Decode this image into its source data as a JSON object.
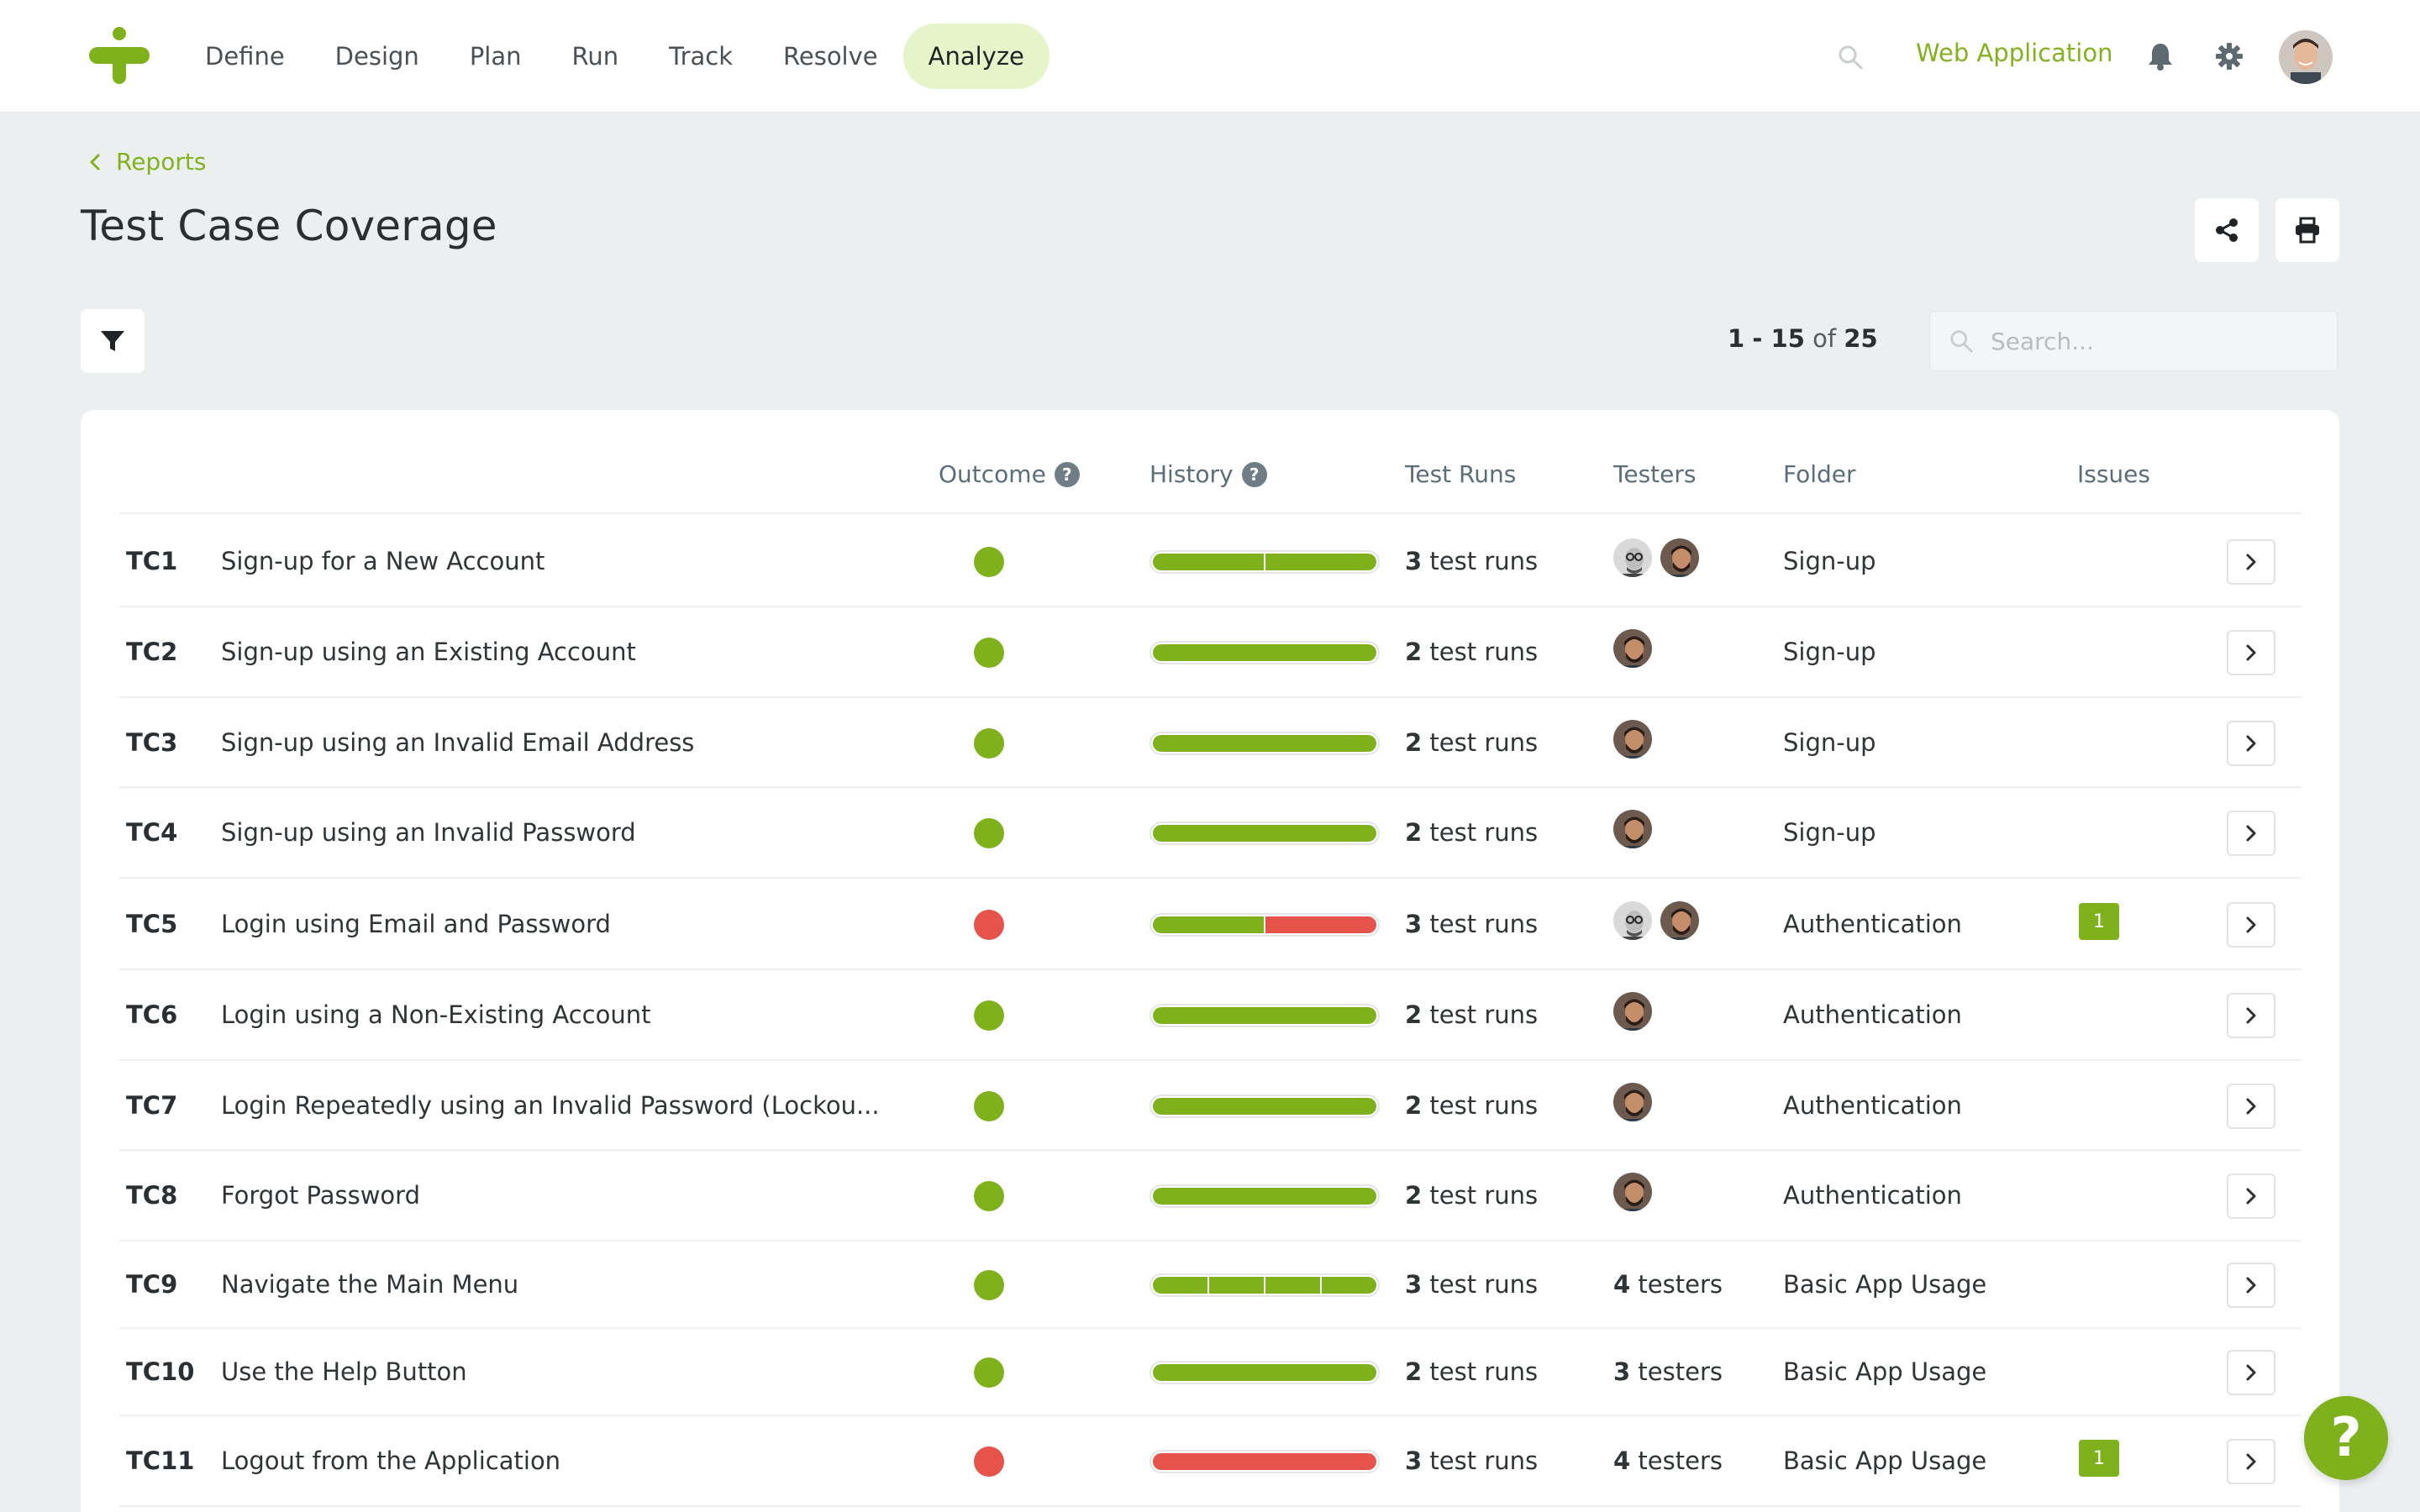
{
  "nav": {
    "items": [
      {
        "label": "Define",
        "active": false
      },
      {
        "label": "Design",
        "active": false
      },
      {
        "label": "Plan",
        "active": false
      },
      {
        "label": "Run",
        "active": false
      },
      {
        "label": "Track",
        "active": false
      },
      {
        "label": "Resolve",
        "active": false
      },
      {
        "label": "Analyze",
        "active": true
      }
    ],
    "project": "Web Application"
  },
  "breadcrumb": "Reports",
  "title": "Test Case Coverage",
  "pager": {
    "from": "1",
    "to": "15",
    "of_label": "of",
    "total": "25"
  },
  "search": {
    "placeholder": "Search..."
  },
  "columns": {
    "outcome": "Outcome",
    "history": "History",
    "test_runs": "Test Runs",
    "testers": "Testers",
    "folder": "Folder",
    "issues": "Issues"
  },
  "colors": {
    "pass": "#7fb11d",
    "fail": "#e5534b",
    "accent": "#82b21d"
  },
  "rows": [
    {
      "id": "TC1",
      "name": "Sign-up for a New Account",
      "outcome": "pass",
      "history": [
        "pass",
        "pass"
      ],
      "runs_count": "3",
      "runs_label": "test runs",
      "testers": [
        "bw",
        "beard"
      ],
      "folder": "Sign-up",
      "issues": ""
    },
    {
      "id": "TC2",
      "name": "Sign-up using an Existing Account",
      "outcome": "pass",
      "history": [
        "pass"
      ],
      "runs_count": "2",
      "runs_label": "test runs",
      "testers": [
        "beard"
      ],
      "folder": "Sign-up",
      "issues": ""
    },
    {
      "id": "TC3",
      "name": "Sign-up using an Invalid Email Address",
      "outcome": "pass",
      "history": [
        "pass"
      ],
      "runs_count": "2",
      "runs_label": "test runs",
      "testers": [
        "beard"
      ],
      "folder": "Sign-up",
      "issues": ""
    },
    {
      "id": "TC4",
      "name": "Sign-up using an Invalid Password",
      "outcome": "pass",
      "history": [
        "pass"
      ],
      "runs_count": "2",
      "runs_label": "test runs",
      "testers": [
        "beard"
      ],
      "folder": "Sign-up",
      "issues": ""
    },
    {
      "id": "TC5",
      "name": "Login using Email and Password",
      "outcome": "fail",
      "history": [
        "pass",
        "fail"
      ],
      "runs_count": "3",
      "runs_label": "test runs",
      "testers": [
        "bw",
        "beard"
      ],
      "folder": "Authentication",
      "issues": "1"
    },
    {
      "id": "TC6",
      "name": "Login using a Non-Existing Account",
      "outcome": "pass",
      "history": [
        "pass"
      ],
      "runs_count": "2",
      "runs_label": "test runs",
      "testers": [
        "beard"
      ],
      "folder": "Authentication",
      "issues": ""
    },
    {
      "id": "TC7",
      "name": "Login Repeatedly using an Invalid Password (Lockou...",
      "outcome": "pass",
      "history": [
        "pass"
      ],
      "runs_count": "2",
      "runs_label": "test runs",
      "testers": [
        "beard"
      ],
      "folder": "Authentication",
      "issues": ""
    },
    {
      "id": "TC8",
      "name": "Forgot Password",
      "outcome": "pass",
      "history": [
        "pass"
      ],
      "runs_count": "2",
      "runs_label": "test runs",
      "testers": [
        "beard"
      ],
      "folder": "Authentication",
      "issues": ""
    },
    {
      "id": "TC9",
      "name": "Navigate the Main Menu",
      "outcome": "pass",
      "history": [
        "pass",
        "pass",
        "pass",
        "pass"
      ],
      "runs_count": "3",
      "runs_label": "test runs",
      "testers_count": "4",
      "testers_label": "testers",
      "folder": "Basic App Usage",
      "issues": ""
    },
    {
      "id": "TC10",
      "name": "Use the Help Button",
      "outcome": "pass",
      "history": [
        "pass"
      ],
      "runs_count": "2",
      "runs_label": "test runs",
      "testers_count": "3",
      "testers_label": "testers",
      "folder": "Basic App Usage",
      "issues": ""
    },
    {
      "id": "TC11",
      "name": "Logout from the Application",
      "outcome": "fail",
      "history": [
        "fail"
      ],
      "runs_count": "3",
      "runs_label": "test runs",
      "testers_count": "4",
      "testers_label": "testers",
      "folder": "Basic App Usage",
      "issues": "1"
    }
  ],
  "help_label": "?"
}
